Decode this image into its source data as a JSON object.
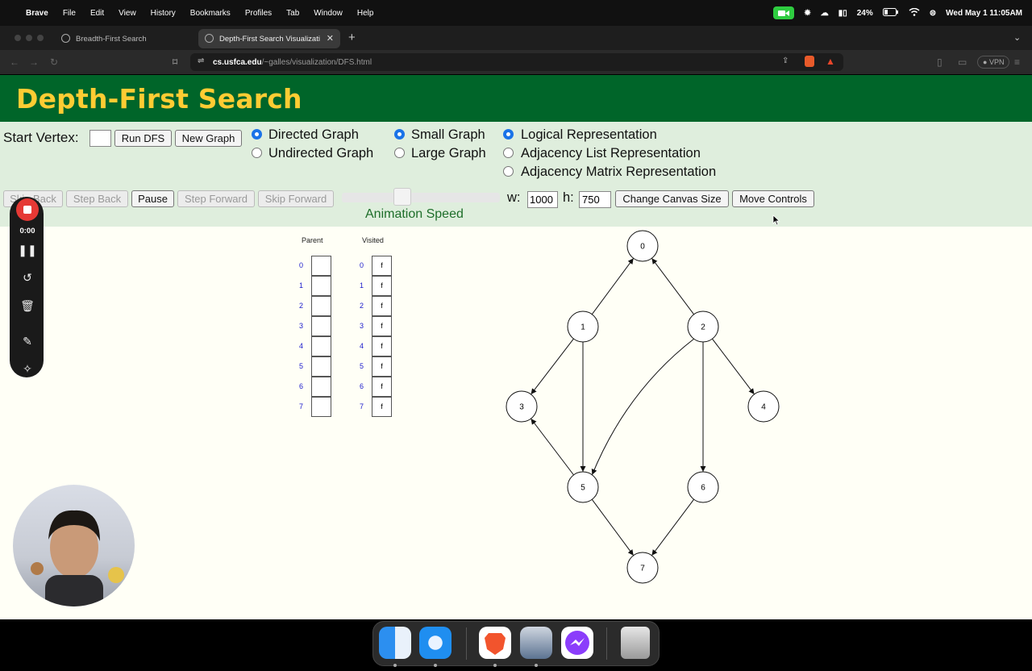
{
  "menubar": {
    "app": "Brave",
    "items": [
      "File",
      "Edit",
      "View",
      "History",
      "Bookmarks",
      "Profiles",
      "Tab",
      "Window",
      "Help"
    ],
    "battery": "24%",
    "clock": "Wed May 1  11:05AM"
  },
  "tabs": [
    {
      "label": "Breadth-First Search"
    },
    {
      "label": "Depth-First Search Visualizati"
    }
  ],
  "address": {
    "host": "cs.usfca.edu",
    "path": "/~galles/visualization/DFS.html"
  },
  "vpn_label": "VPN",
  "header": {
    "title": "Depth-First Search"
  },
  "controls": {
    "start_vertex_label": "Start Vertex:",
    "start_vertex_value": "",
    "run_label": "Run DFS",
    "new_graph_label": "New Graph",
    "directed_label": "Directed Graph",
    "undirected_label": "Undirected Graph",
    "small_label": "Small Graph",
    "large_label": "Large Graph",
    "logical_label": "Logical Representation",
    "adj_list_label": "Adjacency List Representation",
    "adj_matrix_label": "Adjacency Matrix Representation",
    "skip_back_label": "Skip Back",
    "step_back_label": "Step Back",
    "pause_label": "Pause",
    "step_forward_label": "Step Forward",
    "skip_forward_label": "Skip Forward",
    "speed_label": "Animation Speed",
    "w_label": "w:",
    "w_value": "1000",
    "h_label": "h:",
    "h_value": "750",
    "change_canvas_label": "Change Canvas Size",
    "move_controls_label": "Move Controls"
  },
  "tables": {
    "parent_header": "Parent",
    "visited_header": "Visited",
    "indices": [
      "0",
      "1",
      "2",
      "3",
      "4",
      "5",
      "6",
      "7"
    ],
    "parent_values": [
      "",
      "",
      "",
      "",
      "",
      "",
      "",
      ""
    ],
    "visited_values": [
      "f",
      "f",
      "f",
      "f",
      "f",
      "f",
      "f",
      "f"
    ]
  },
  "graph": {
    "vertices": [
      "0",
      "1",
      "2",
      "3",
      "4",
      "5",
      "6",
      "7"
    ],
    "edges": [
      {
        "from": "1",
        "to": "0"
      },
      {
        "from": "2",
        "to": "0"
      },
      {
        "from": "1",
        "to": "3"
      },
      {
        "from": "1",
        "to": "5"
      },
      {
        "from": "2",
        "to": "5"
      },
      {
        "from": "2",
        "to": "4"
      },
      {
        "from": "2",
        "to": "6"
      },
      {
        "from": "5",
        "to": "3"
      },
      {
        "from": "5",
        "to": "7"
      },
      {
        "from": "6",
        "to": "7"
      }
    ]
  },
  "recorder": {
    "time": "0:00"
  }
}
